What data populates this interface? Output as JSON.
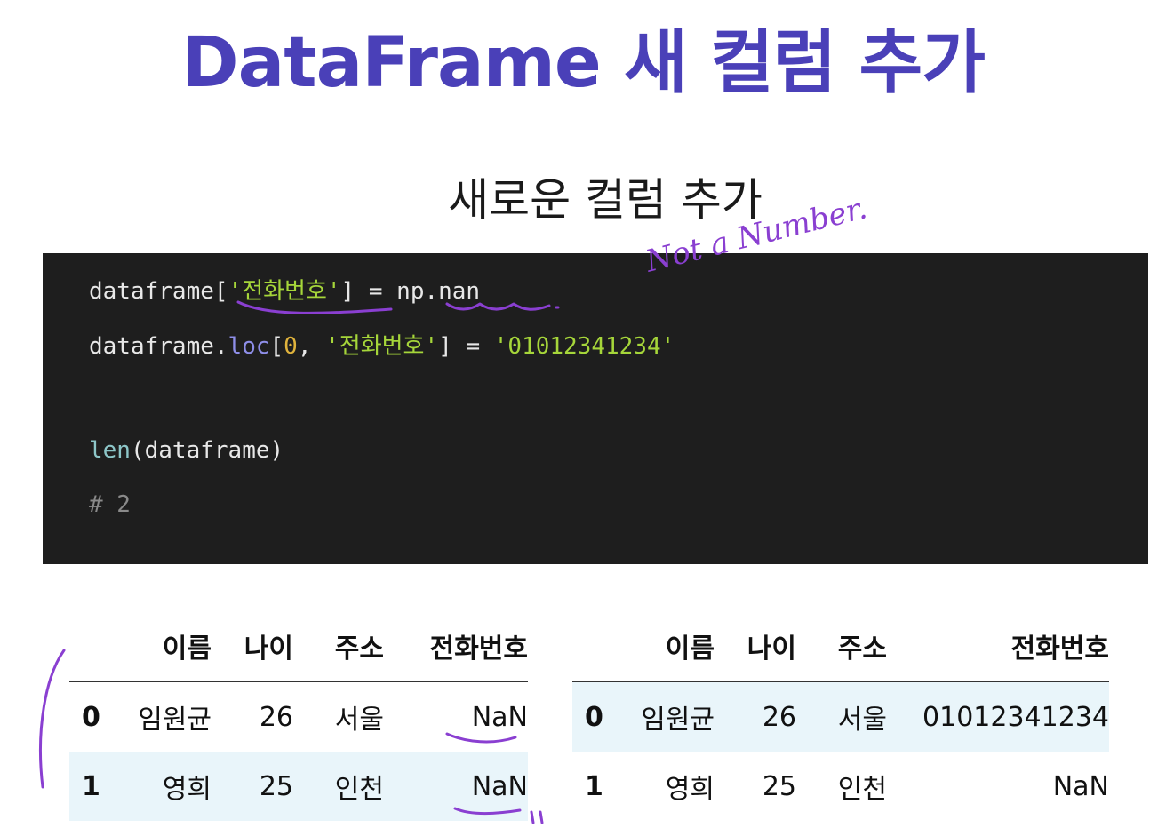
{
  "title": "DataFrame 새 컬럼 추가",
  "subtitle": "새로운 컬럼 추가",
  "code": {
    "line1": {
      "a": "dataframe[",
      "b": "'전화번호'",
      "c": "] = np.nan"
    },
    "line2": {
      "a": "dataframe.",
      "b": "loc",
      "c": "[",
      "d": "0",
      "e": ", ",
      "f": "'전화번호'",
      "g": "] = ",
      "h": "'01012341234'"
    },
    "line3": {
      "a": "len",
      "b": "(dataframe)"
    },
    "line4": "# 2"
  },
  "annotation": "Not a Number.",
  "table_left": {
    "headers": [
      "",
      "이름",
      "나이",
      "주소",
      "전화번호"
    ],
    "rows": [
      [
        "0",
        "임원균",
        "26",
        "서울",
        "NaN"
      ],
      [
        "1",
        "영희",
        "25",
        "인천",
        "NaN"
      ]
    ]
  },
  "table_right": {
    "headers": [
      "",
      "이름",
      "나이",
      "주소",
      "전화번호"
    ],
    "rows": [
      [
        "0",
        "임원균",
        "26",
        "서울",
        "01012341234"
      ],
      [
        "1",
        "영희",
        "25",
        "인천",
        "NaN"
      ]
    ]
  },
  "colors": {
    "title": "#4a40b8",
    "code_bg": "#1e1e1e",
    "ink": "#8a3fd1",
    "row_shade": "#e9f5fa"
  }
}
